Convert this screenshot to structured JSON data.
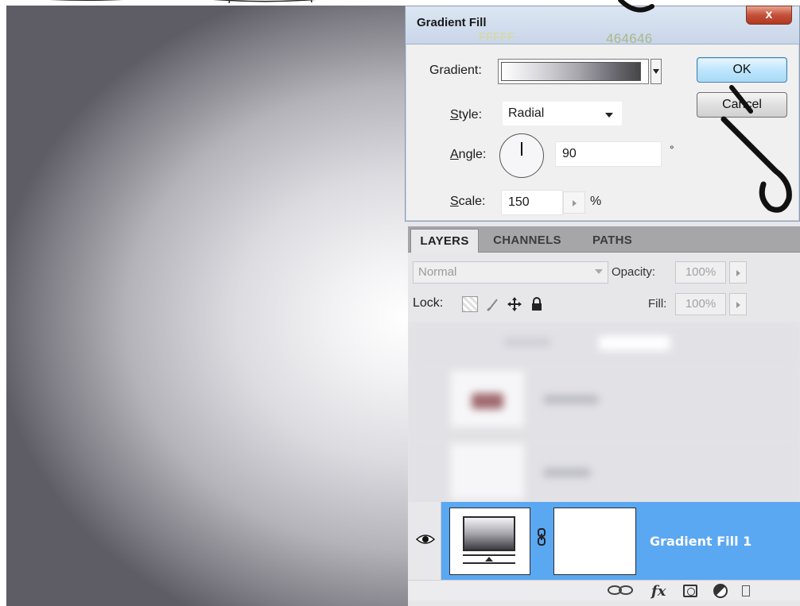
{
  "dialog": {
    "title": "Gradient Fill",
    "annotation_start_hex": "FFFFF",
    "annotation_end_hex": "464646",
    "close_label": "x",
    "gradient_label": "Gradient:",
    "style_label_first": "S",
    "style_label_rest": "tyle:",
    "style_value": "Radial",
    "angle_label_first": "A",
    "angle_label_rest": "ngle:",
    "angle_value": "90",
    "degree_symbol": "°",
    "scale_label_first": "S",
    "scale_label_rest": "cale:",
    "scale_value": "150",
    "percent_symbol": "%",
    "ok_label": "OK",
    "cancel_label": "Cancel",
    "gradient_colors": [
      "#ffffff",
      "#464646"
    ]
  },
  "layers_panel": {
    "tabs": [
      "LAYERS",
      "CHANNELS",
      "PATHS"
    ],
    "blend_mode": "Normal",
    "opacity_label": "Opacity:",
    "opacity_value": "100%",
    "lock_label": "Lock:",
    "fill_label": "Fill:",
    "fill_value": "100%",
    "selected_layer_name": "Gradient Fill 1",
    "footer_fx": "fx"
  },
  "colors": {
    "selection": "#5aa7f2",
    "close_button": "#c45039",
    "ok_border": "#3c7fb1",
    "panel_bg": "#e7e7ea"
  }
}
